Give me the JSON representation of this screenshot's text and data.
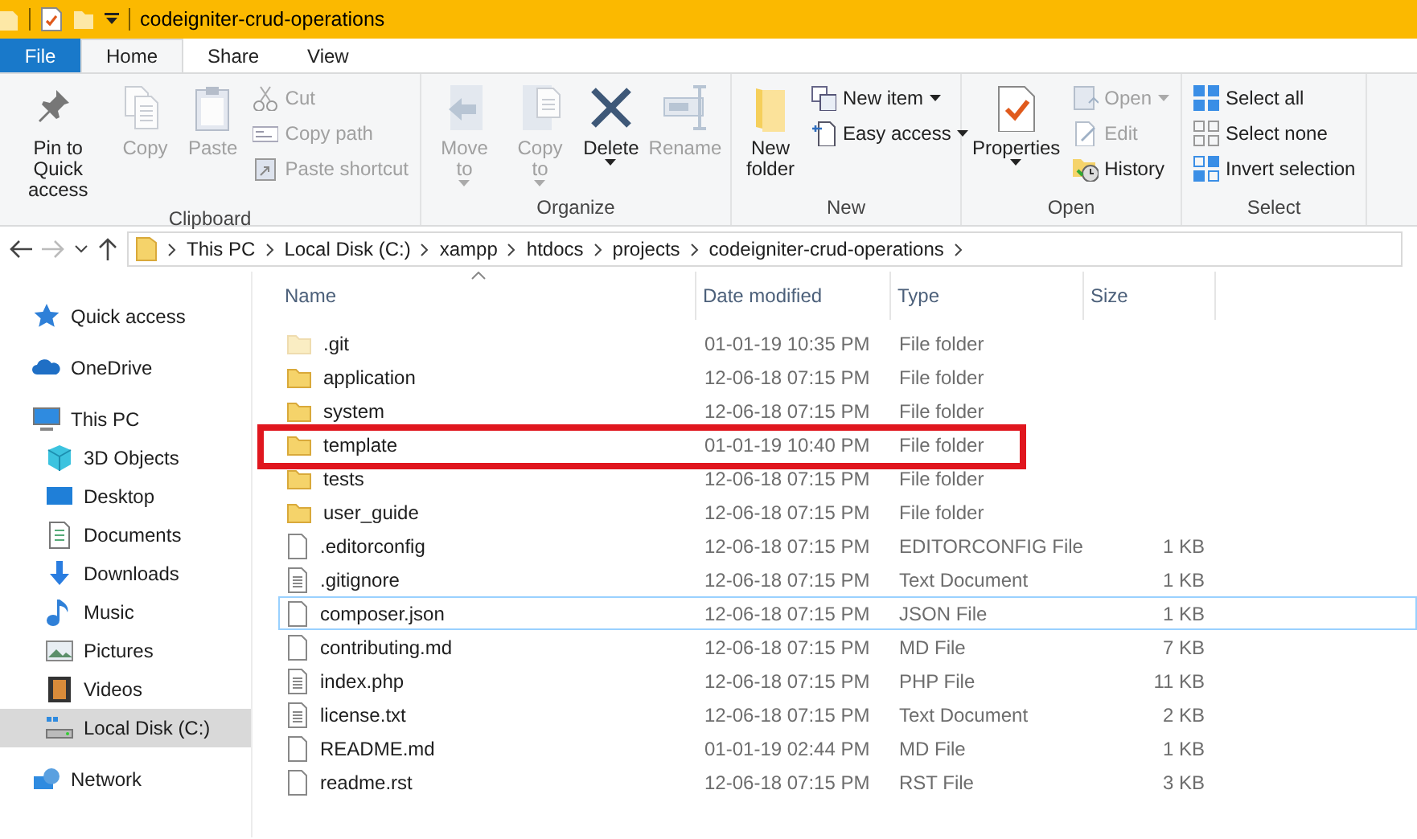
{
  "window": {
    "title": "codeigniter-crud-operations"
  },
  "tabs": [
    {
      "label": "File",
      "kind": "file",
      "selected": false
    },
    {
      "label": "Home",
      "kind": "tab",
      "selected": true
    },
    {
      "label": "Share",
      "kind": "tab",
      "selected": false
    },
    {
      "label": "View",
      "kind": "tab",
      "selected": false
    }
  ],
  "ribbon": [
    {
      "label": "Clipboard",
      "items": [
        {
          "label": "Pin to Quick access",
          "kind": "large",
          "disabled": false,
          "dropdown": false
        },
        {
          "label": "Copy",
          "kind": "large",
          "disabled": true,
          "dropdown": false
        },
        {
          "label": "Paste",
          "kind": "large",
          "disabled": true,
          "dropdown": false
        },
        {
          "label": "Cut",
          "kind": "small",
          "disabled": true,
          "dropdown": false
        },
        {
          "label": "Copy path",
          "kind": "small",
          "disabled": true,
          "dropdown": false
        },
        {
          "label": "Paste shortcut",
          "kind": "small",
          "disabled": true,
          "dropdown": false
        }
      ]
    },
    {
      "label": "Organize",
      "items": [
        {
          "label": "Move to",
          "kind": "large",
          "disabled": true,
          "dropdown": true
        },
        {
          "label": "Copy to",
          "kind": "large",
          "disabled": true,
          "dropdown": true
        },
        {
          "label": "Delete",
          "kind": "large",
          "disabled": false,
          "dropdown": true
        },
        {
          "label": "Rename",
          "kind": "large",
          "disabled": true,
          "dropdown": false
        }
      ]
    },
    {
      "label": "New",
      "items": [
        {
          "label": "New folder",
          "kind": "large",
          "disabled": false,
          "dropdown": false
        },
        {
          "label": "New item",
          "kind": "small",
          "disabled": false,
          "dropdown": true
        },
        {
          "label": "Easy access",
          "kind": "small",
          "disabled": false,
          "dropdown": true
        }
      ]
    },
    {
      "label": "Open",
      "items": [
        {
          "label": "Properties",
          "kind": "large",
          "disabled": false,
          "dropdown": true
        },
        {
          "label": "Open",
          "kind": "small",
          "disabled": true,
          "dropdown": true
        },
        {
          "label": "Edit",
          "kind": "small",
          "disabled": true,
          "dropdown": false
        },
        {
          "label": "History",
          "kind": "small",
          "disabled": false,
          "dropdown": false
        }
      ]
    },
    {
      "label": "Select",
      "items": [
        {
          "label": "Select all",
          "kind": "small",
          "disabled": false,
          "dropdown": false
        },
        {
          "label": "Select none",
          "kind": "small",
          "disabled": false,
          "dropdown": false
        },
        {
          "label": "Invert selection",
          "kind": "small",
          "disabled": false,
          "dropdown": false
        }
      ]
    }
  ],
  "address": {
    "forward_disabled": true,
    "path": [
      "This PC",
      "Local Disk (C:)",
      "xampp",
      "htdocs",
      "projects",
      "codeigniter-crud-operations"
    ]
  },
  "sidebar": {
    "items": [
      {
        "label": "Quick access",
        "selected": false
      },
      {
        "label": "OneDrive",
        "selected": false
      },
      {
        "label": "This PC",
        "selected": false,
        "children": [
          {
            "label": "3D Objects",
            "selected": false
          },
          {
            "label": "Desktop",
            "selected": false
          },
          {
            "label": "Documents",
            "selected": false
          },
          {
            "label": "Downloads",
            "selected": false
          },
          {
            "label": "Music",
            "selected": false
          },
          {
            "label": "Pictures",
            "selected": false
          },
          {
            "label": "Videos",
            "selected": false
          },
          {
            "label": "Local Disk (C:)",
            "selected": true
          }
        ]
      },
      {
        "label": "Network",
        "selected": false
      }
    ]
  },
  "table": {
    "columns": [
      "Name",
      "Date modified",
      "Type",
      "Size"
    ],
    "rows": [
      {
        "name": ".git",
        "date": "01-01-19 10:35 PM",
        "type": "File folder",
        "kind": "folder",
        "hidden": true,
        "focused": false,
        "highlighted": false
      },
      {
        "name": "application",
        "date": "12-06-18 07:15 PM",
        "type": "File folder",
        "kind": "folder",
        "hidden": false,
        "focused": false,
        "highlighted": false
      },
      {
        "name": "system",
        "date": "12-06-18 07:15 PM",
        "type": "File folder",
        "kind": "folder",
        "hidden": false,
        "focused": false,
        "highlighted": false
      },
      {
        "name": "template",
        "date": "01-01-19 10:40 PM",
        "type": "File folder",
        "kind": "folder",
        "hidden": false,
        "focused": false,
        "highlighted": true
      },
      {
        "name": "tests",
        "date": "12-06-18 07:15 PM",
        "type": "File folder",
        "kind": "folder",
        "hidden": false,
        "focused": false,
        "highlighted": false
      },
      {
        "name": "user_guide",
        "date": "12-06-18 07:15 PM",
        "type": "File folder",
        "kind": "folder",
        "hidden": false,
        "focused": false,
        "highlighted": false
      },
      {
        "name": ".editorconfig",
        "date": "12-06-18 07:15 PM",
        "type": "EDITORCONFIG File",
        "size": "1 KB",
        "kind": "file",
        "hidden": false,
        "focused": false,
        "highlighted": false
      },
      {
        "name": ".gitignore",
        "date": "12-06-18 07:15 PM",
        "type": "Text Document",
        "size": "1 KB",
        "kind": "text",
        "hidden": false,
        "focused": false,
        "highlighted": false
      },
      {
        "name": "composer.json",
        "date": "12-06-18 07:15 PM",
        "type": "JSON File",
        "size": "1 KB",
        "kind": "file",
        "hidden": false,
        "focused": true,
        "highlighted": false
      },
      {
        "name": "contributing.md",
        "date": "12-06-18 07:15 PM",
        "type": "MD File",
        "size": "7 KB",
        "kind": "file",
        "hidden": false,
        "focused": false,
        "highlighted": false
      },
      {
        "name": "index.php",
        "date": "12-06-18 07:15 PM",
        "type": "PHP File",
        "size": "11 KB",
        "kind": "text",
        "hidden": false,
        "focused": false,
        "highlighted": false
      },
      {
        "name": "license.txt",
        "date": "12-06-18 07:15 PM",
        "type": "Text Document",
        "size": "2 KB",
        "kind": "text",
        "hidden": false,
        "focused": false,
        "highlighted": false
      },
      {
        "name": "README.md",
        "date": "01-01-19 02:44 PM",
        "type": "MD File",
        "size": "1 KB",
        "kind": "file",
        "hidden": false,
        "focused": false,
        "highlighted": false
      },
      {
        "name": "readme.rst",
        "date": "12-06-18 07:15 PM",
        "type": "RST File",
        "size": "3 KB",
        "kind": "file",
        "hidden": false,
        "focused": false,
        "highlighted": false
      }
    ]
  }
}
